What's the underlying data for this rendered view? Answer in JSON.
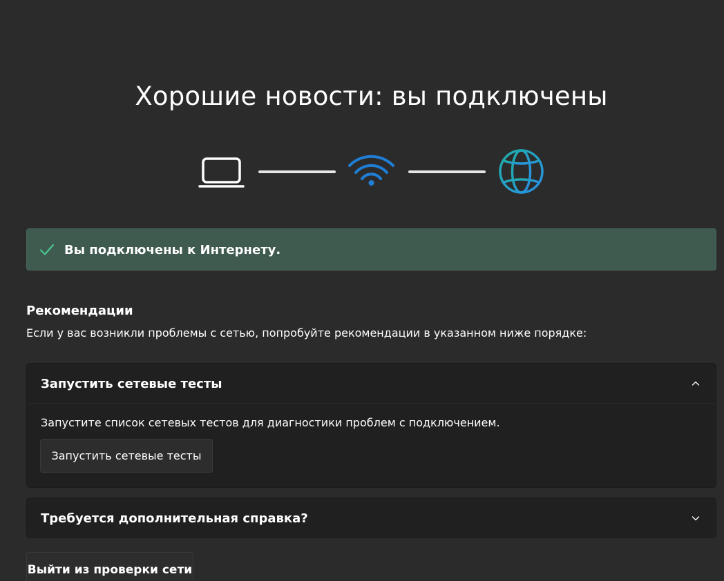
{
  "title": "Хорошие новости: вы подключены",
  "diagram": {
    "icons": [
      "laptop-icon",
      "wifi-icon",
      "globe-icon"
    ],
    "colors": {
      "laptop": "#ffffff",
      "line": "#e6e6e6",
      "wifi": "#1f7fd6",
      "globe_start": "#1fb0a8",
      "globe_end": "#2a8ee6"
    }
  },
  "status": {
    "icon": "checkmark-icon",
    "text": "Вы подключены к Интернету.",
    "background": "#3f5a4f",
    "check_color": "#4cc790"
  },
  "recommendations": {
    "heading": "Рекомендации",
    "description": "Если у вас возникли проблемы с сетью, попробуйте рекомендации в указанном ниже порядке:",
    "cards": [
      {
        "title": "Запустить сетевые тесты",
        "expanded": true,
        "chevron": "chevron-up-icon",
        "body": "Запустите список сетевых тестов для диагностики проблем с подключением.",
        "button_label": "Запустить сетевые тесты"
      },
      {
        "title": "Требуется дополнительная справка?",
        "expanded": false,
        "chevron": "chevron-down-icon"
      }
    ]
  },
  "footer": {
    "exit_label": "Выйти из проверки сети"
  }
}
